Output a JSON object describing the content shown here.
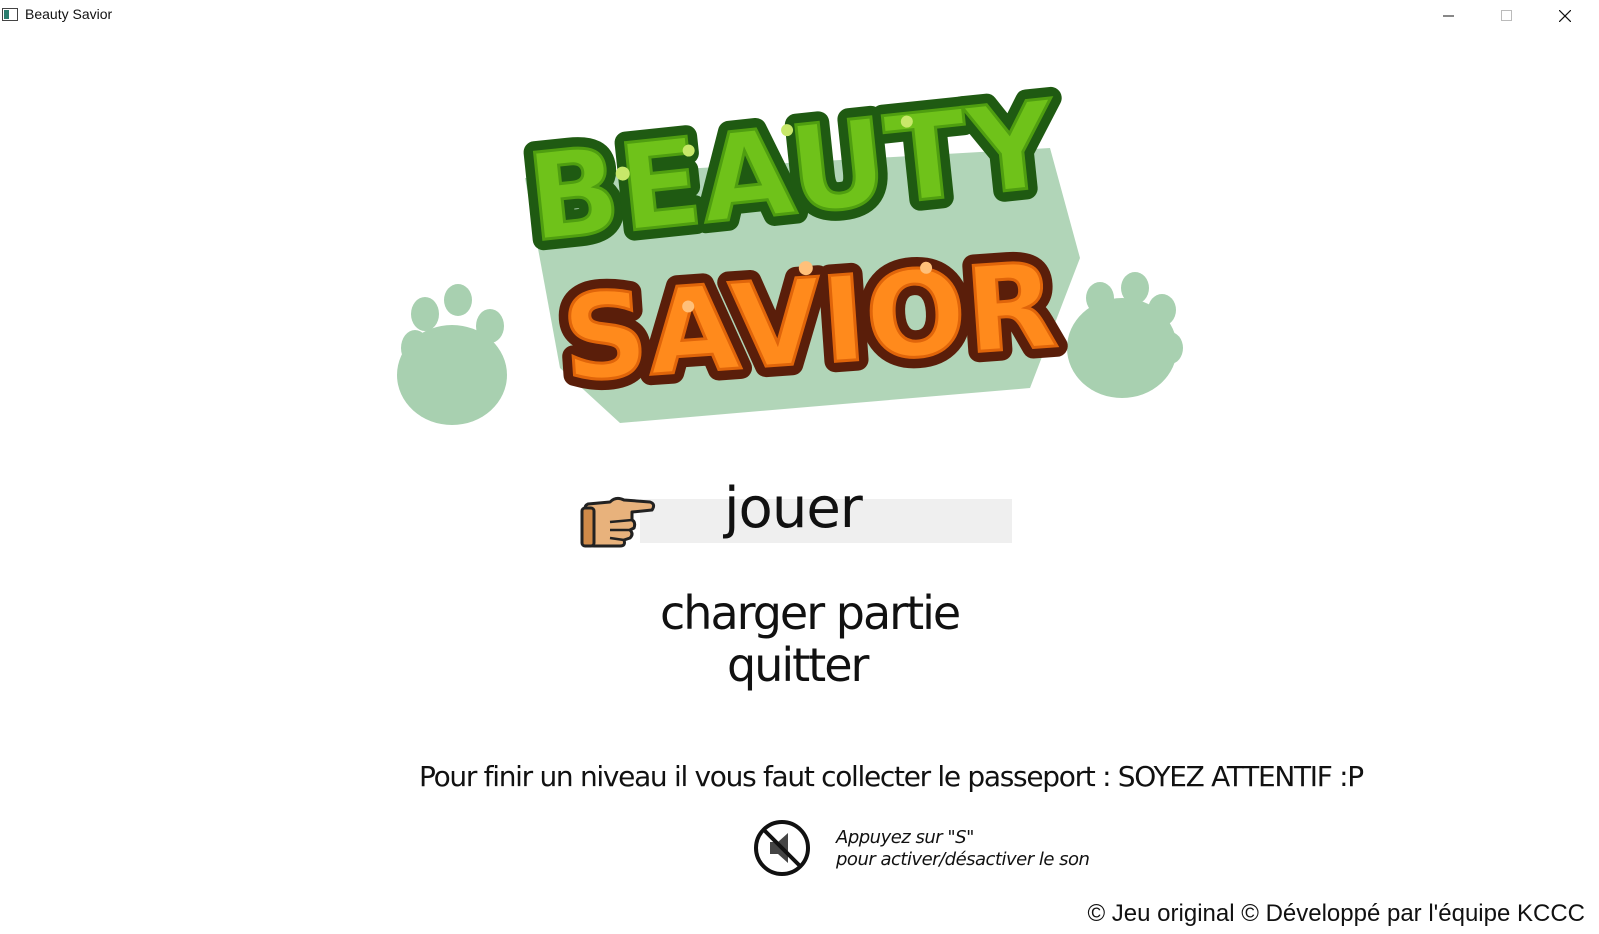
{
  "window": {
    "title": "Beauty Savior",
    "controls": [
      "minimize-icon",
      "maximize-icon",
      "close-icon"
    ]
  },
  "logo": {
    "line1": "BEAUTY",
    "line2": "SAVIOR",
    "colors": {
      "green": "#6fc21a",
      "green_dark": "#1f5a12",
      "orange": "#ff8a1c",
      "orange_dark": "#5a1e0a",
      "paw": "#a8d0b0"
    }
  },
  "menu": {
    "selected_icon": "pointing-hand-icon",
    "items": [
      {
        "label": "jouer",
        "selected": true
      },
      {
        "label": "charger partie",
        "selected": false
      },
      {
        "label": "quitter",
        "selected": false
      }
    ]
  },
  "hint": "Pour finir un niveau il vous faut collecter le passeport : SOYEZ ATTENTIF :P",
  "sound": {
    "icon": "sound-muted-icon",
    "line1": "Appuyez sur \"S\"",
    "line2": "pour activer/désactiver le son"
  },
  "footer": "© Jeu original © Développé par l'équipe KCCC"
}
